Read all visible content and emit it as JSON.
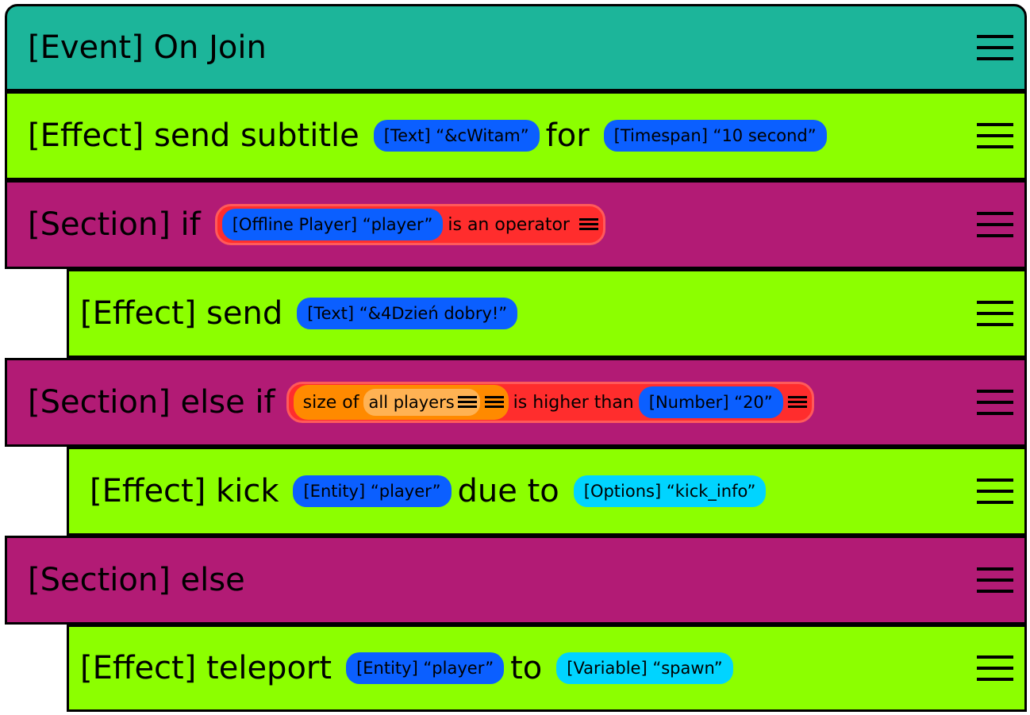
{
  "colors": {
    "event": "#1cb59a",
    "effect": "#8cff00",
    "section": "#b21b75",
    "pill_blue": "#0b5fff",
    "pill_cyan": "#00d4ff",
    "pill_red": "#ff2d2d",
    "pill_orange": "#ff8a00"
  },
  "blocks": {
    "event": {
      "label": "[Event] On Join"
    },
    "subtitle": {
      "label": "[Effect] send subtitle",
      "text_pill": "[Text] “&cWitam”",
      "for": "for",
      "timespan_pill": "[Timespan] “10 second”"
    },
    "if": {
      "label": "[Section] if",
      "player_pill": "[Offline Player] “player”",
      "condition": "is an operator"
    },
    "send": {
      "label": "[Effect] send",
      "text_pill": "[Text] “&4Dzień dobry!”"
    },
    "elseif": {
      "label": "[Section] else if",
      "size_of": "size of",
      "all_players": "all players",
      "comparison": "is higher than",
      "number_pill": "[Number] “20”"
    },
    "kick": {
      "label": "[Effect] kick",
      "entity_pill": "[Entity] “player”",
      "due_to": "due to",
      "options_pill": "[Options] “kick_info”"
    },
    "else": {
      "label": "[Section] else"
    },
    "teleport": {
      "label": "[Effect] teleport",
      "entity_pill": "[Entity] “player”",
      "to": "to",
      "variable_pill": "[Variable] “spawn”"
    }
  }
}
